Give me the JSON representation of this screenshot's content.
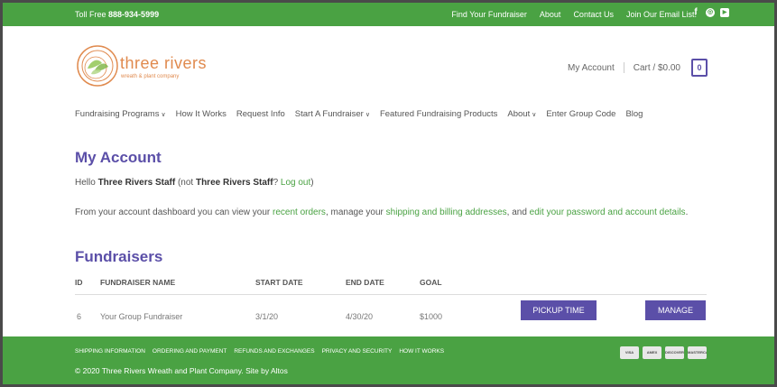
{
  "topbar": {
    "toll_free_label": "Toll Free",
    "phone": "888-934-5999",
    "links": [
      "Find Your Fundraiser",
      "About",
      "Contact Us",
      "Join Our Email List!"
    ],
    "social_icons": [
      "facebook-icon",
      "instagram-icon",
      "youtube-icon"
    ]
  },
  "logo": {
    "name": "three rivers",
    "tagline": "wreath & plant company"
  },
  "header": {
    "my_account": "My Account",
    "cart": "Cart / $0.00",
    "cart_count": "0"
  },
  "nav": [
    {
      "label": "Fundraising Programs",
      "dropdown": true
    },
    {
      "label": "How It Works",
      "dropdown": false
    },
    {
      "label": "Request Info",
      "dropdown": false
    },
    {
      "label": "Start A Fundraiser",
      "dropdown": true
    },
    {
      "label": "Featured Fundraising Products",
      "dropdown": false
    },
    {
      "label": "About",
      "dropdown": true
    },
    {
      "label": "Enter Group Code",
      "dropdown": false
    },
    {
      "label": "Blog",
      "dropdown": false
    }
  ],
  "account": {
    "title": "My Account",
    "hello_prefix": "Hello",
    "user": "Three Rivers Staff",
    "not_prefix": "(not",
    "not_user": "Three Rivers Staff",
    "question": "?",
    "logout": "Log out",
    "close_paren": ")",
    "dash_1": "From your account dashboard you can view your",
    "recent_orders": "recent orders",
    "dash_2": ", manage your",
    "addresses": "shipping and billing addresses",
    "dash_3": ", and",
    "edit": "edit your password and account details",
    "dash_4": "."
  },
  "fundraisers": {
    "title": "Fundraisers",
    "columns": [
      "ID",
      "FUNDRAISER NAME",
      "START DATE",
      "END DATE",
      "GOAL"
    ],
    "rows": [
      {
        "id": "6",
        "name": "Your Group Fundraiser",
        "start": "3/1/20",
        "end": "4/30/20",
        "goal": "$1000",
        "pickup": "PICKUP TIME",
        "manage": "MANAGE"
      }
    ]
  },
  "footer": {
    "links": [
      "SHIPPING INFORMATION",
      "ORDERING AND PAYMENT",
      "REFUNDS AND EXCHANGES",
      "PRIVACY AND SECURITY",
      "HOW IT WORKS"
    ],
    "copyright": "© 2020 Three Rivers Wreath and Plant Company. Site by Altos",
    "cards": [
      "VISA",
      "AMEX",
      "DISCOVER",
      "MASTERCARD"
    ]
  },
  "colors": {
    "green": "#4aa243",
    "purple": "#5b4fa8",
    "logo_orange": "#e08a4e"
  }
}
